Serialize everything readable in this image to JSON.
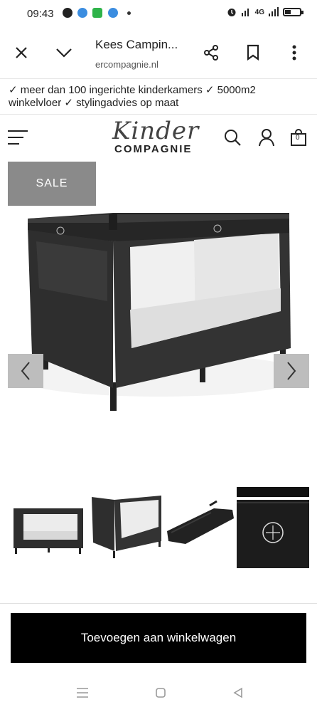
{
  "status": {
    "time": "09:43",
    "network": "4G"
  },
  "browser": {
    "tab_title": "Kees Campin...",
    "url": "ercompagnie.nl"
  },
  "usp": {
    "line": "✓ meer dan 100 ingerichte kinderkamers ✓ 5000m2 winkelvloer ✓ stylingadvies op maat"
  },
  "header": {
    "logo_script": "Kinder",
    "logo_sub": "COMPAGNIE",
    "cart_count": "0"
  },
  "product": {
    "badge": "SALE"
  },
  "cart": {
    "button_label": "Toevoegen aan winkelwagen"
  },
  "icons": {
    "close": "close-icon",
    "chevron": "chevron-down-icon",
    "share": "share-icon",
    "bookmark": "bookmark-icon",
    "more": "more-vert-icon",
    "menu": "hamburger-icon",
    "search": "search-icon",
    "account": "user-icon",
    "cart": "cart-icon"
  },
  "colors": {
    "badge_bg": "#8a8a8a",
    "cta_bg": "#000000",
    "arrow_bg": "#bdbdbd"
  }
}
